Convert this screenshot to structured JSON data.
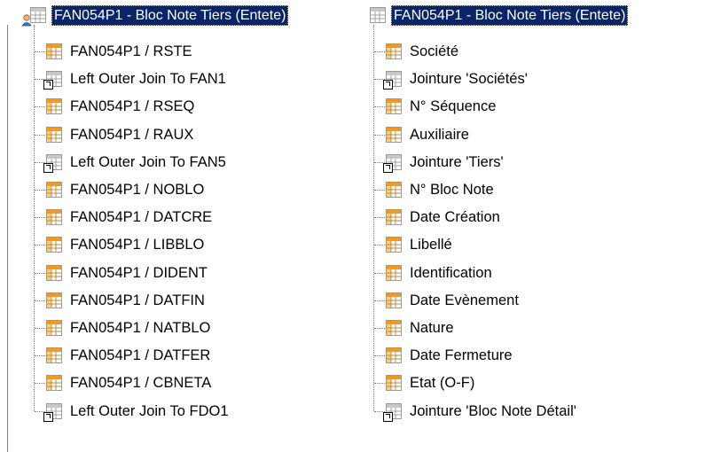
{
  "left_tree": {
    "root_label": "FAN054P1 - Bloc Note Tiers (Entete)",
    "items": [
      {
        "label": "FAN054P1 / RSTE",
        "icon": "orange-table-icon"
      },
      {
        "label": "Left Outer Join To FAN1",
        "icon": "join-link-icon"
      },
      {
        "label": "FAN054P1 / RSEQ",
        "icon": "orange-table-icon"
      },
      {
        "label": "FAN054P1 / RAUX",
        "icon": "orange-table-icon"
      },
      {
        "label": "Left Outer Join To FAN5",
        "icon": "join-link-icon"
      },
      {
        "label": "FAN054P1 / NOBLO",
        "icon": "orange-table-icon"
      },
      {
        "label": "FAN054P1 / DATCRE",
        "icon": "orange-table-icon"
      },
      {
        "label": "FAN054P1 / LIBBLO",
        "icon": "orange-table-icon"
      },
      {
        "label": "FAN054P1 / DIDENT",
        "icon": "orange-table-icon"
      },
      {
        "label": "FAN054P1 / DATFIN",
        "icon": "orange-table-icon"
      },
      {
        "label": "FAN054P1 / NATBLO",
        "icon": "orange-table-icon"
      },
      {
        "label": "FAN054P1 / DATFER",
        "icon": "orange-table-icon"
      },
      {
        "label": "FAN054P1 / CBNETA",
        "icon": "orange-table-icon"
      },
      {
        "label": "Left Outer Join To FDO1",
        "icon": "join-link-icon"
      }
    ]
  },
  "right_tree": {
    "root_label": "FAN054P1 - Bloc Note Tiers (Entete)",
    "items": [
      {
        "label": "Société",
        "icon": "orange-table-icon"
      },
      {
        "label": "Jointure 'Sociétés'",
        "icon": "join-link-icon"
      },
      {
        "label": "N° Séquence",
        "icon": "orange-table-icon"
      },
      {
        "label": "Auxiliaire",
        "icon": "orange-table-icon"
      },
      {
        "label": "Jointure 'Tiers'",
        "icon": "join-link-icon"
      },
      {
        "label": "N° Bloc Note",
        "icon": "orange-table-icon"
      },
      {
        "label": "Date Création",
        "icon": "orange-table-icon"
      },
      {
        "label": "Libellé",
        "icon": "orange-table-icon"
      },
      {
        "label": "Identification",
        "icon": "orange-table-icon"
      },
      {
        "label": "Date Evènement",
        "icon": "orange-table-icon"
      },
      {
        "label": "Nature",
        "icon": "orange-table-icon"
      },
      {
        "label": "Date Fermeture",
        "icon": "orange-table-icon"
      },
      {
        "label": "Etat (O-F)",
        "icon": "orange-table-icon"
      },
      {
        "label": "Jointure 'Bloc Note Détail'",
        "icon": "join-link-icon"
      }
    ]
  },
  "colors": {
    "selection_bg": "#0a246a",
    "orange_icon": "#f39a1e",
    "join_icon": "#c8c8c8"
  }
}
